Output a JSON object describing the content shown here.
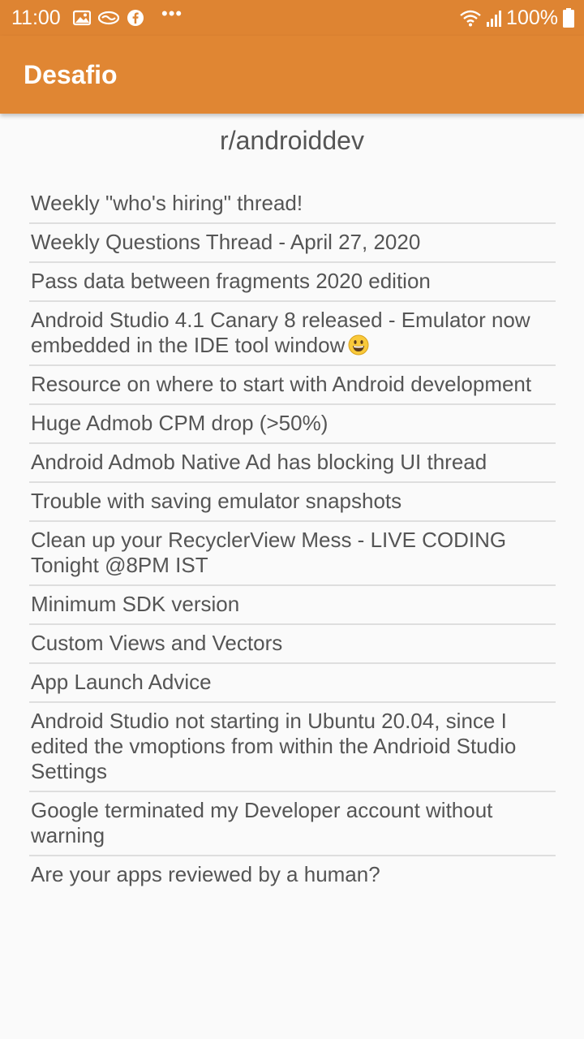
{
  "status_bar": {
    "time": "11:00",
    "battery": "100%",
    "icons": [
      "gallery-icon",
      "handshake-icon",
      "facebook-icon",
      "more-icon",
      "wifi-icon",
      "signal-icon",
      "battery-icon"
    ],
    "more": "•••"
  },
  "app_bar": {
    "title": "Desafio",
    "color": "#e08633"
  },
  "subreddit": {
    "title": "r/androiddev"
  },
  "posts": [
    {
      "title": "Weekly \"who's hiring\" thread!"
    },
    {
      "title": "Weekly Questions Thread - April 27, 2020"
    },
    {
      "title": "Pass data between fragments 2020 edition"
    },
    {
      "title": "Android Studio 4.1 Canary 8 released - Emulator now embedded in the IDE tool window",
      "emoji": "grinning-face-icon"
    },
    {
      "title": "Resource on where to start with Android development"
    },
    {
      "title": "Huge Admob CPM drop (>50%)"
    },
    {
      "title": "Android Admob Native Ad has blocking UI thread"
    },
    {
      "title": "Trouble with saving emulator snapshots"
    },
    {
      "title": "Clean up your RecyclerView Mess - LIVE CODING Tonight @8PM IST"
    },
    {
      "title": "Minimum SDK version"
    },
    {
      "title": "Custom Views and Vectors"
    },
    {
      "title": "App Launch Advice"
    },
    {
      "title": "Android Studio not starting in Ubuntu 20.04, since I edited the vmoptions from within the Andrioid Studio Settings"
    },
    {
      "title": "Google terminated my Developer account without warning"
    },
    {
      "title": "Are your apps reviewed by a human?"
    }
  ]
}
